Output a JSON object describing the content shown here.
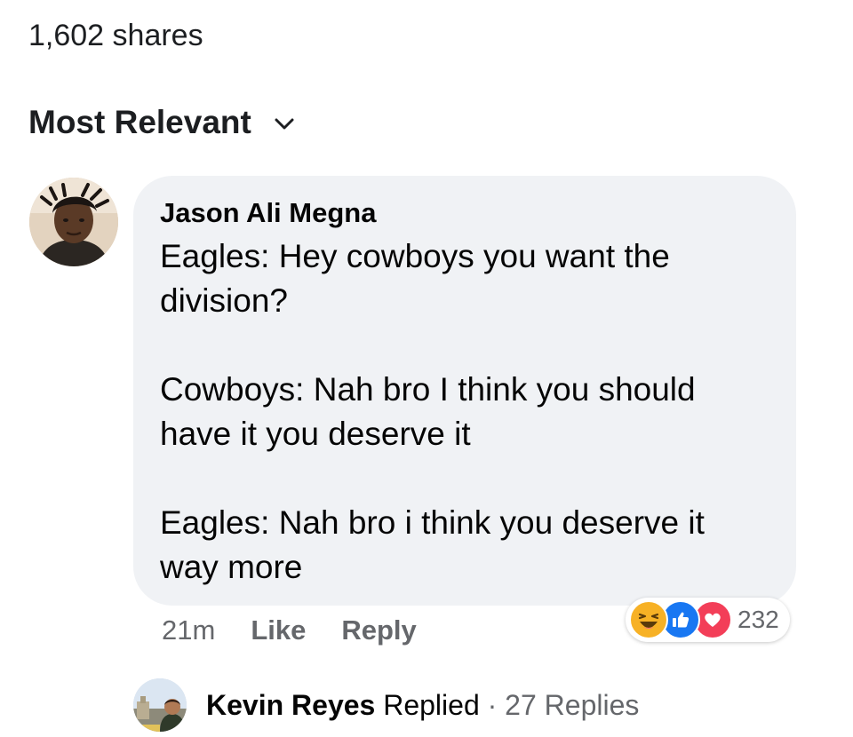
{
  "post": {
    "shares_text": "1,602 shares"
  },
  "sort": {
    "label": "Most Relevant",
    "icon": "chevron-down-icon"
  },
  "comment": {
    "author": "Jason Ali Megna",
    "text": "Eagles: Hey cowboys you want the division?\n\nCowboys: Nah bro I think you should have it you deserve it\n\nEagles: Nah bro i think you deserve it way more",
    "time": "21m",
    "like_label": "Like",
    "reply_label": "Reply",
    "reactions": {
      "icons": [
        "haha-icon",
        "like-icon",
        "love-icon"
      ],
      "count": "232"
    }
  },
  "reply_summary": {
    "name": "Kevin Reyes",
    "action": "Replied",
    "separator": "·",
    "count_text": "27 Replies"
  },
  "colors": {
    "bubble": "#f0f2f5",
    "secondary_text": "#65676b",
    "like_blue": "#1877f2",
    "love_red": "#f33e58",
    "haha_yellow": "#f7b125"
  }
}
